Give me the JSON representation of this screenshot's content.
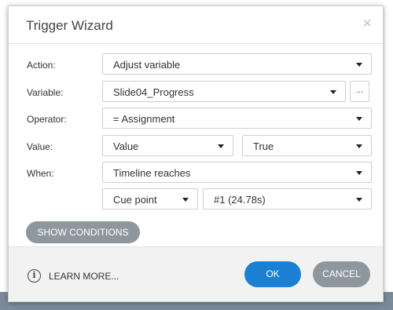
{
  "dialog": {
    "title": "Trigger Wizard",
    "close_glyph": "×"
  },
  "form": {
    "action": {
      "label": "Action:",
      "value": "Adjust variable"
    },
    "variable": {
      "label": "Variable:",
      "value": "Slide04_Progress",
      "more_label": "..."
    },
    "operator": {
      "label": "Operator:",
      "value": "= Assignment"
    },
    "value": {
      "label": "Value:",
      "type_value": "Value",
      "value": "True"
    },
    "when": {
      "label": "When:",
      "value": "Timeline reaches",
      "cue_type": "Cue point",
      "cue_value": "#1 (24.78s)"
    }
  },
  "buttons": {
    "show_conditions": "SHOW CONDITIONS",
    "learn_more": "LEARN MORE...",
    "info_glyph": "i",
    "ok": "OK",
    "cancel": "CANCEL"
  }
}
